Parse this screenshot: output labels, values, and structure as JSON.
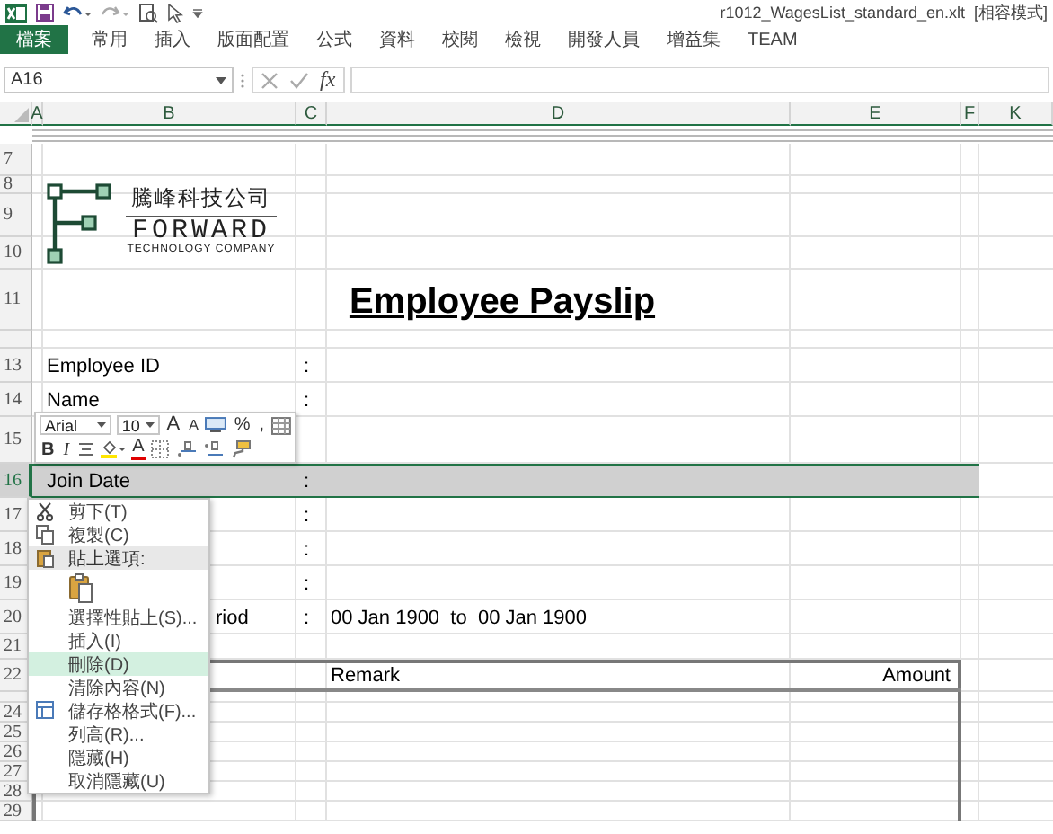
{
  "title_bar": {
    "filename": "r1012_WagesList_standard_en.xlt  [相容模式]"
  },
  "ribbon_tabs": [
    {
      "label": "檔案",
      "selected": true
    },
    {
      "label": "常用",
      "selected": false
    },
    {
      "label": "插入",
      "selected": false
    },
    {
      "label": "版面配置",
      "selected": false
    },
    {
      "label": "公式",
      "selected": false
    },
    {
      "label": "資料",
      "selected": false
    },
    {
      "label": "校閱",
      "selected": false
    },
    {
      "label": "檢視",
      "selected": false
    },
    {
      "label": "開發人員",
      "selected": false
    },
    {
      "label": "增益集",
      "selected": false
    },
    {
      "label": "TEAM",
      "selected": false
    }
  ],
  "formula_bar": {
    "name_box": "A16",
    "function_label": "fx"
  },
  "column_headers": [
    "A",
    "B",
    "C",
    "D",
    "E",
    "F",
    "K"
  ],
  "logo": {
    "name_zh": "騰峰科技公司",
    "name": "FORWARD",
    "tagline": "TECHNOLOGY COMPANY"
  },
  "rows": [
    {
      "number": "7",
      "kind": "blank",
      "selected": false
    },
    {
      "number": "8",
      "kind": "thin",
      "selected": false
    },
    {
      "number": "9",
      "kind": "logo",
      "selected": false
    },
    {
      "number": "10",
      "kind": "blank",
      "selected": false
    },
    {
      "number": "11",
      "kind": "title",
      "title": "Employee Payslip",
      "selected": false
    },
    {
      "kind": "thin",
      "selected": false
    },
    {
      "number": "13",
      "kind": "field",
      "label": "Employee ID",
      "separator": ":",
      "selected": false
    },
    {
      "number": "14",
      "kind": "field",
      "label": "Name",
      "separator": ":",
      "selected": false
    },
    {
      "number": "15",
      "kind": "tall",
      "selected": false
    },
    {
      "number": "16",
      "kind": "field",
      "label": "Join Date",
      "separator": ":",
      "selected": true
    },
    {
      "number": "17",
      "kind": "field",
      "separator": ":",
      "selected": false
    },
    {
      "number": "18",
      "kind": "field",
      "separator": ":",
      "selected": false
    },
    {
      "number": "19",
      "kind": "field",
      "separator": ":",
      "selected": false
    },
    {
      "number": "20",
      "kind": "field",
      "label": "riod",
      "separator": ":",
      "value": "00 Jan 1900  to  00 Jan 1900",
      "selected": false
    },
    {
      "number": "21",
      "kind": "short",
      "selected": false
    },
    {
      "number": "22",
      "kind": "table-header",
      "remark": "Remark",
      "amount": "Amount",
      "selected": false
    },
    {
      "kind": "table-thin",
      "selected": false
    },
    {
      "number": "24",
      "kind": "table",
      "selected": false
    },
    {
      "number": "25",
      "kind": "table",
      "selected": false
    },
    {
      "number": "26",
      "kind": "table",
      "selected": false
    },
    {
      "number": "27",
      "kind": "table",
      "selected": false
    },
    {
      "number": "28",
      "kind": "table",
      "selected": false
    },
    {
      "number": "29",
      "kind": "table",
      "selected": false
    }
  ],
  "mini_toolbar": {
    "font": "Arial",
    "size": "10",
    "grow": "A",
    "shrink": "A",
    "percent": "%",
    "comma": ",",
    "bold": "B",
    "italic": "I",
    "font_color": "A"
  },
  "context_menu": [
    {
      "kind": "item",
      "label": "剪下(T)",
      "highlighted": false
    },
    {
      "kind": "item",
      "label": "複製(C)",
      "highlighted": false
    },
    {
      "kind": "header",
      "label": "貼上選項:"
    },
    {
      "kind": "paste-options"
    },
    {
      "kind": "item",
      "label": "選擇性貼上(S)...",
      "highlighted": false
    },
    {
      "kind": "item",
      "label": "插入(I)",
      "highlighted": false
    },
    {
      "kind": "item",
      "label": "刪除(D)",
      "highlighted": true
    },
    {
      "kind": "item",
      "label": "清除內容(N)",
      "highlighted": false
    },
    {
      "kind": "item",
      "label": "儲存格格式(F)...",
      "highlighted": false
    },
    {
      "kind": "item",
      "label": "列高(R)...",
      "highlighted": false
    },
    {
      "kind": "item",
      "label": "隱藏(H)",
      "highlighted": false
    },
    {
      "kind": "item",
      "label": "取消隱藏(U)",
      "highlighted": false
    }
  ]
}
